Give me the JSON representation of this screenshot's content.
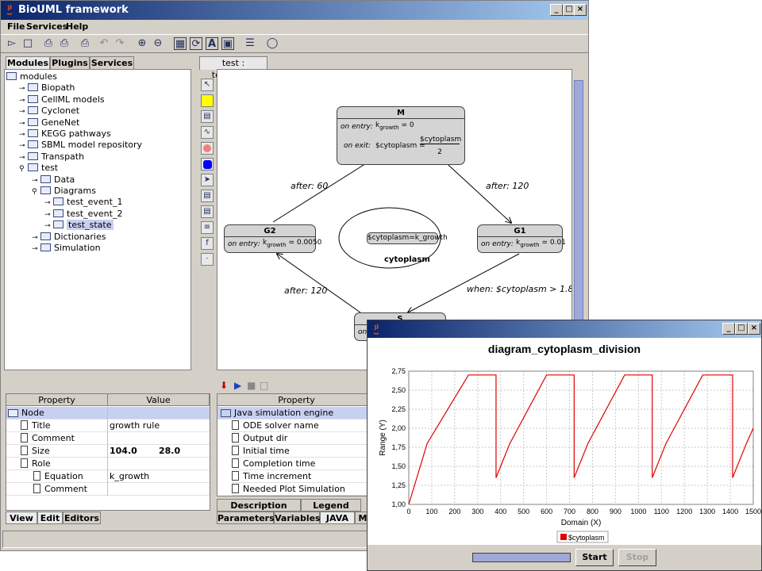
{
  "app": {
    "title": "BioUML framework",
    "menu": [
      "File",
      "Services",
      "Help"
    ],
    "window_buttons": [
      "_",
      "□",
      "×"
    ]
  },
  "toolbar": {
    "icons": [
      "open-icon",
      "new-icon",
      "print-icon",
      "print-preview-icon",
      "undo-icon",
      "redo-icon",
      "zoom-in-icon",
      "zoom-out-icon",
      "fit-icon",
      "layout-icon",
      "text-icon",
      "select-all-icon",
      "options-icon",
      "help-icon"
    ]
  },
  "left_tabs": [
    "Modules",
    "Plugins",
    "Services"
  ],
  "tree": [
    {
      "label": "modules",
      "level": 0
    },
    {
      "label": "Biopath",
      "level": 1
    },
    {
      "label": "CellML models",
      "level": 1
    },
    {
      "label": "Cyclonet",
      "level": 1
    },
    {
      "label": "GeneNet",
      "level": 1
    },
    {
      "label": "KEGG pathways",
      "level": 1
    },
    {
      "label": "SBML model repository",
      "level": 1
    },
    {
      "label": "Transpath",
      "level": 1
    },
    {
      "label": "test",
      "level": 1
    },
    {
      "label": "Data",
      "level": 2
    },
    {
      "label": "Diagrams",
      "level": 2
    },
    {
      "label": "test_event_1",
      "level": 3
    },
    {
      "label": "test_event_2",
      "level": 3
    },
    {
      "label": "test_state",
      "level": 3,
      "selected": true
    },
    {
      "label": "Dictionaries",
      "level": 2
    },
    {
      "label": "Simulation",
      "level": 2
    }
  ],
  "diagram": {
    "tab": "test : test_state",
    "states": {
      "M": {
        "name": "M",
        "entry_label": "on entry:",
        "entry_expr": "k",
        "entry_sub": "growth",
        "entry_val": "= 0",
        "exit_label": "on exit:",
        "exit_lhs": "$cytoplasm =",
        "exit_num": "$cytoplasm",
        "exit_den": "2"
      },
      "G2": {
        "name": "G2",
        "entry_label": "on entry:",
        "entry_expr": "k",
        "entry_sub": "growth",
        "entry_val": "= 0.0050"
      },
      "G1": {
        "name": "G1",
        "entry_label": "on entry:",
        "entry_expr": "k",
        "entry_sub": "growth",
        "entry_val": "= 0.01"
      },
      "S": {
        "name": "S",
        "entry_label": "on entry:"
      }
    },
    "compartment": {
      "name": "cytoplasm",
      "rule": "$cytoplasm=k_growth"
    },
    "transitions": [
      "after: 60",
      "after: 120",
      "after: 120",
      "when: $cytoplasm > 1.8"
    ]
  },
  "property_panel": {
    "columns": [
      "Property",
      "Value"
    ],
    "rows": [
      {
        "name": "Node",
        "value": "",
        "level": 0,
        "selected": true
      },
      {
        "name": "Title",
        "value": "growth rule",
        "level": 1
      },
      {
        "name": "Comment",
        "value": "",
        "level": 1
      },
      {
        "name": "Size",
        "value": "104.0",
        "value2": "28.0",
        "level": 1
      },
      {
        "name": "Role",
        "value": "",
        "level": 1
      },
      {
        "name": "Equation",
        "value": "k_growth",
        "level": 2
      },
      {
        "name": "Comment",
        "value": "",
        "level": 2
      }
    ],
    "tabs": [
      "View",
      "Edit",
      "Editors"
    ]
  },
  "sim_panel": {
    "column": "Property",
    "root": "Java simulation engine",
    "rows": [
      "ODE solver name",
      "Output dir",
      "Initial time",
      "Completion time",
      "Time increment",
      "Needed Plot Simulation"
    ],
    "tabs_top": [
      "Description",
      "Legend"
    ],
    "tabs_bottom": [
      "Parameters",
      "Variables",
      "JAVA",
      "M"
    ]
  },
  "plot_window": {
    "title": "",
    "buttons": {
      "start": "Start",
      "stop": "Stop"
    },
    "progress": 1.0
  },
  "chart_data": {
    "type": "line",
    "title": "diagram_cytoplasm_division",
    "xlabel": "Domain (X)",
    "ylabel": "Range (Y)",
    "xlim": [
      0,
      1500
    ],
    "ylim": [
      1.0,
      2.75
    ],
    "xticks": [
      "0",
      "100",
      "200",
      "300",
      "400",
      "500",
      "600",
      "700",
      "800",
      "900",
      "1000",
      "1100",
      "1200",
      "1300",
      "1400",
      "1500"
    ],
    "yticks": [
      "1,00",
      "1,25",
      "1,50",
      "1,75",
      "2,00",
      "2,25",
      "2,50",
      "2,75"
    ],
    "grid": true,
    "legend": "bottom",
    "series": [
      {
        "name": "$cytoplasm",
        "color": "#e00000",
        "x": [
          0,
          80,
          260,
          380,
          380,
          440,
          600,
          720,
          720,
          780,
          940,
          1060,
          1060,
          1120,
          1280,
          1410,
          1410,
          1470,
          1500
        ],
        "y": [
          1.0,
          1.8,
          2.7,
          2.7,
          1.35,
          1.8,
          2.7,
          2.7,
          1.35,
          1.8,
          2.7,
          2.7,
          1.35,
          1.8,
          2.7,
          2.7,
          1.35,
          1.8,
          2.0
        ]
      }
    ]
  }
}
